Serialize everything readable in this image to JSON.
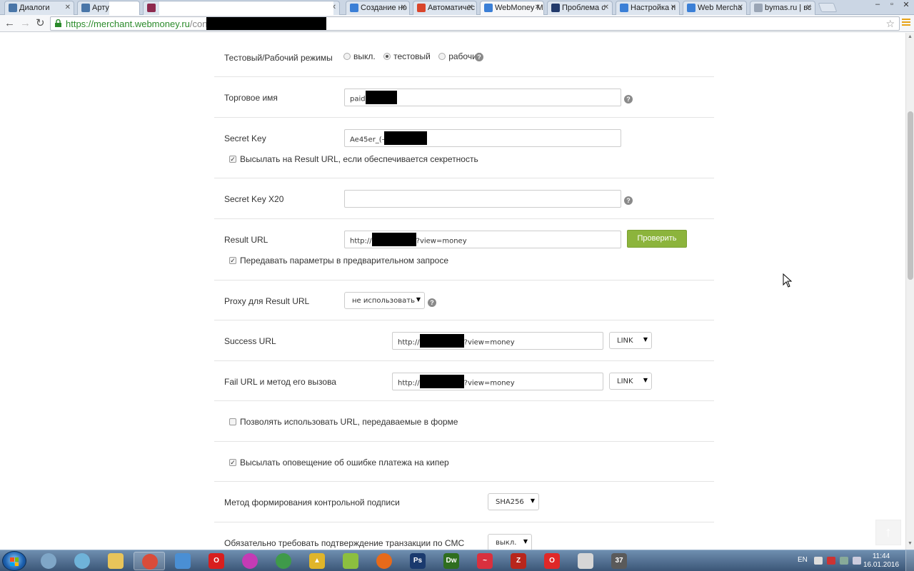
{
  "browser": {
    "tabs": [
      {
        "label": "Диалоги",
        "favicon": "vk-icon",
        "color": "#4a76a8",
        "active": false
      },
      {
        "label": "Артур",
        "favicon": "vk-icon",
        "color": "#4a76a8",
        "active": false
      },
      {
        "label": "",
        "favicon": "book-icon",
        "color": "#8e2a4f",
        "active": false
      },
      {
        "label": "Создание но",
        "favicon": "globe-icon",
        "color": "#3b7fd6",
        "active": false
      },
      {
        "label": "Автоматичес",
        "favicon": "feather-icon",
        "color": "#d9452b",
        "active": false
      },
      {
        "label": "WebMoney M",
        "favicon": "globe-icon",
        "color": "#3b7fd6",
        "active": true
      },
      {
        "label": "Проблема с",
        "favicon": "php-icon",
        "color": "#223a6b",
        "active": false
      },
      {
        "label": "Настройка п",
        "favicon": "globe-icon",
        "color": "#3b7fd6",
        "active": false
      },
      {
        "label": "Web Mercha",
        "favicon": "globe-icon",
        "color": "#3b7fd6",
        "active": false
      },
      {
        "label": "bymas.ru | вс",
        "favicon": "page-icon",
        "color": "#9aa5b5",
        "active": false
      }
    ],
    "url_host": "https://merchant.webmoney.ru",
    "url_path": "/conf/",
    "window_controls": {
      "minimize": "–",
      "maximize": "▫",
      "close": "✕"
    }
  },
  "form": {
    "mode": {
      "label": "Тестовый/Рабочий режимы",
      "options": [
        "выкл.",
        "тестовый",
        "рабочий"
      ],
      "selected": "тестовый",
      "help": "?"
    },
    "trade_name": {
      "label": "Торговое имя",
      "value": "paid",
      "help": "?"
    },
    "secret_key": {
      "label": "Secret Key",
      "value": "Ae45er_(-",
      "checkbox_label": "Высылать на Result URL, если обеспечивается секретность",
      "checked": true
    },
    "secret_key_x20": {
      "label": "Secret Key X20",
      "value": "",
      "help": "?"
    },
    "result_url": {
      "label": "Result URL",
      "prefix": "http://",
      "suffix": "?view=money",
      "button": "Проверить",
      "button_color": "#8cb43c",
      "checkbox_label": "Передавать параметры в предварительном запросе",
      "checked": true
    },
    "proxy": {
      "label": "Proxy для Result URL",
      "selected": "не использовать",
      "help": "?"
    },
    "success_url": {
      "label": "Success URL",
      "prefix": "http://",
      "suffix": "?view=money",
      "method": "LINK"
    },
    "fail_url": {
      "label": "Fail URL и метод его вызова",
      "prefix": "http://",
      "suffix": "?view=money",
      "method": "LINK"
    },
    "allow_form_urls": {
      "label": "Позволять использовать URL, передаваемые в форме",
      "checked": false
    },
    "notify_keeper": {
      "label": "Высылать оповещение об ошибке платежа на кипер",
      "checked": true
    },
    "signature_method": {
      "label": "Метод формирования контрольной подписи",
      "selected": "SHA256"
    },
    "sms_confirm": {
      "label": "Обязательно требовать подтверждение транзакции по СМС",
      "selected": "выкл."
    }
  },
  "taskbar": {
    "language": "EN",
    "time": "11:44",
    "date": "16.01.2016",
    "apps": [
      {
        "name": "ie-tuner-icon",
        "color": "#7fa6c7",
        "text": ""
      },
      {
        "name": "qip-icon",
        "color": "#6fb3d9",
        "text": ""
      },
      {
        "name": "explorer-folder-icon",
        "color": "#e8c45a",
        "text": ""
      },
      {
        "name": "chrome-icon",
        "color": "#d94c3a",
        "text": ""
      },
      {
        "name": "skype-note-icon",
        "color": "#4a8fd4",
        "text": ""
      },
      {
        "name": "opera-icon",
        "color": "#d81e1e",
        "text": "O"
      },
      {
        "name": "color-picker-icon",
        "color": "#c43bb5",
        "text": ""
      },
      {
        "name": "globe-app-icon",
        "color": "#3f9a4a",
        "text": ""
      },
      {
        "name": "keeper-icon",
        "color": "#e0b52a",
        "text": "▲"
      },
      {
        "name": "notepad-icon",
        "color": "#8cbf3f",
        "text": ""
      },
      {
        "name": "firefox-icon",
        "color": "#e66a1a",
        "text": ""
      },
      {
        "name": "photoshop-icon",
        "color": "#1a3a6e",
        "text": "Ps"
      },
      {
        "name": "dreamweaver-icon",
        "color": "#2f6e1f",
        "text": "Dw"
      },
      {
        "name": "airline-icon",
        "color": "#d9303e",
        "text": "~"
      },
      {
        "name": "filezilla-icon",
        "color": "#b8261c",
        "text": "Z"
      },
      {
        "name": "opera-next-icon",
        "color": "#e02828",
        "text": "O"
      },
      {
        "name": "document-icon",
        "color": "#d6d6d6",
        "text": ""
      },
      {
        "name": "calendar-icon",
        "color": "#5a5a5a",
        "text": "37"
      }
    ]
  }
}
